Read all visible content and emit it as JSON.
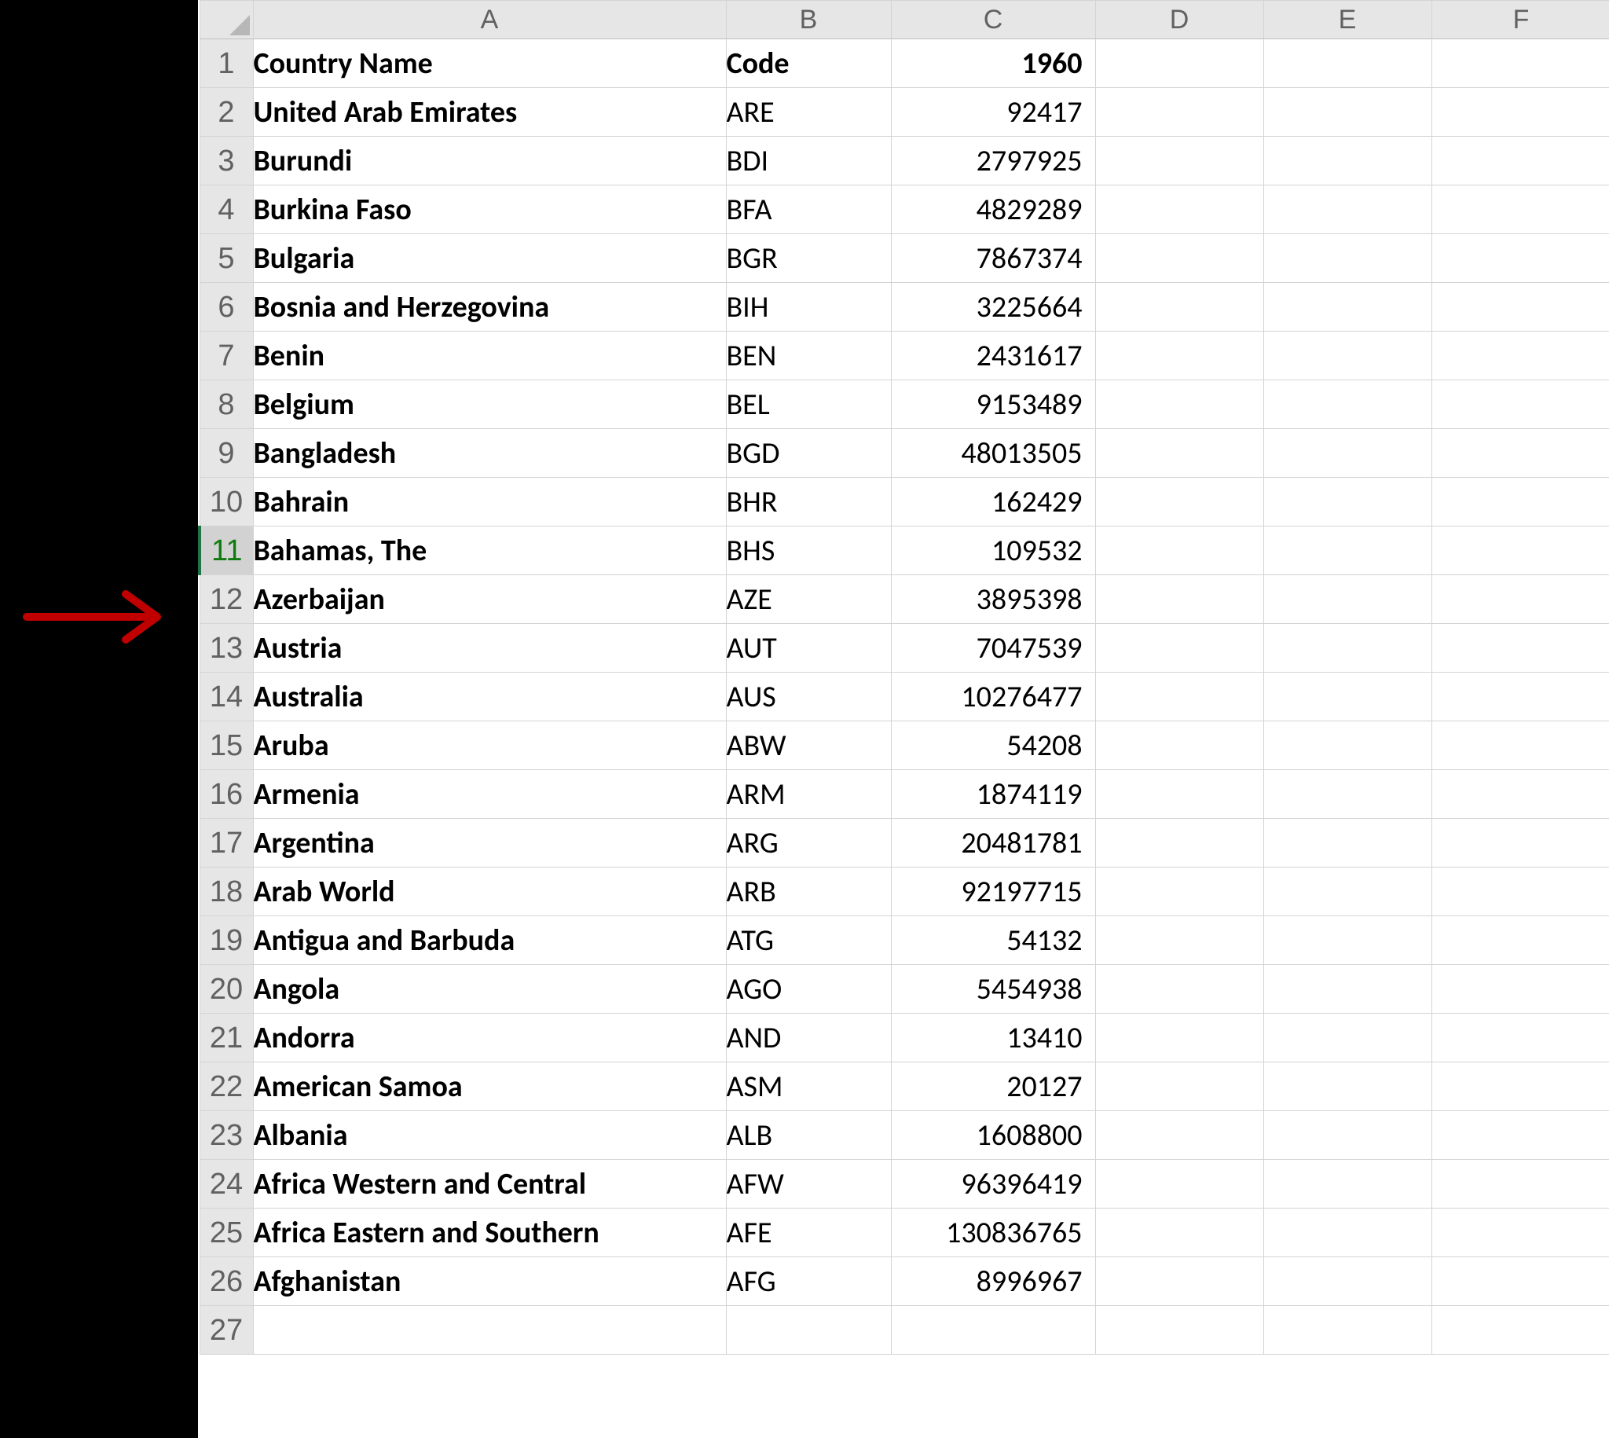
{
  "spreadsheet": {
    "column_letters": [
      "A",
      "B",
      "C",
      "D",
      "E",
      "F"
    ],
    "header": {
      "country_name": "Country Name",
      "code": "Code",
      "year": "1960"
    },
    "rows": [
      {
        "num": "1",
        "country": "Country Name",
        "code": "Code",
        "value": "1960",
        "is_header": true
      },
      {
        "num": "2",
        "country": "United Arab Emirates",
        "code": "ARE",
        "value": "92417"
      },
      {
        "num": "3",
        "country": "Burundi",
        "code": "BDI",
        "value": "2797925"
      },
      {
        "num": "4",
        "country": "Burkina Faso",
        "code": "BFA",
        "value": "4829289"
      },
      {
        "num": "5",
        "country": "Bulgaria",
        "code": "BGR",
        "value": "7867374"
      },
      {
        "num": "6",
        "country": "Bosnia and Herzegovina",
        "code": "BIH",
        "value": "3225664"
      },
      {
        "num": "7",
        "country": "Benin",
        "code": "BEN",
        "value": "2431617"
      },
      {
        "num": "8",
        "country": "Belgium",
        "code": "BEL",
        "value": "9153489"
      },
      {
        "num": "9",
        "country": "Bangladesh",
        "code": "BGD",
        "value": "48013505"
      },
      {
        "num": "10",
        "country": "Bahrain",
        "code": "BHR",
        "value": "162429"
      },
      {
        "num": "11",
        "country": "Bahamas, The",
        "code": "BHS",
        "value": "109532",
        "highlight": true
      },
      {
        "num": "12",
        "country": "Azerbaijan",
        "code": "AZE",
        "value": "3895398"
      },
      {
        "num": "13",
        "country": "Austria",
        "code": "AUT",
        "value": "7047539"
      },
      {
        "num": "14",
        "country": "Australia",
        "code": "AUS",
        "value": "10276477"
      },
      {
        "num": "15",
        "country": "Aruba",
        "code": "ABW",
        "value": "54208"
      },
      {
        "num": "16",
        "country": "Armenia",
        "code": "ARM",
        "value": "1874119"
      },
      {
        "num": "17",
        "country": "Argentina",
        "code": "ARG",
        "value": "20481781"
      },
      {
        "num": "18",
        "country": "Arab World",
        "code": "ARB",
        "value": "92197715"
      },
      {
        "num": "19",
        "country": "Antigua and Barbuda",
        "code": "ATG",
        "value": "54132"
      },
      {
        "num": "20",
        "country": "Angola",
        "code": "AGO",
        "value": "5454938"
      },
      {
        "num": "21",
        "country": "Andorra",
        "code": "AND",
        "value": "13410"
      },
      {
        "num": "22",
        "country": "American Samoa",
        "code": "ASM",
        "value": "20127"
      },
      {
        "num": "23",
        "country": "Albania",
        "code": "ALB",
        "value": "1608800"
      },
      {
        "num": "24",
        "country": "Africa Western and Central",
        "code": "AFW",
        "value": "96396419"
      },
      {
        "num": "25",
        "country": "Africa Eastern and Southern",
        "code": "AFE",
        "value": "130836765"
      },
      {
        "num": "26",
        "country": "Afghanistan",
        "code": "AFG",
        "value": "8996967"
      },
      {
        "num": "27",
        "country": "",
        "code": "",
        "value": ""
      }
    ],
    "annotation": {
      "points_to_row": "11",
      "color": "#c00000"
    }
  }
}
